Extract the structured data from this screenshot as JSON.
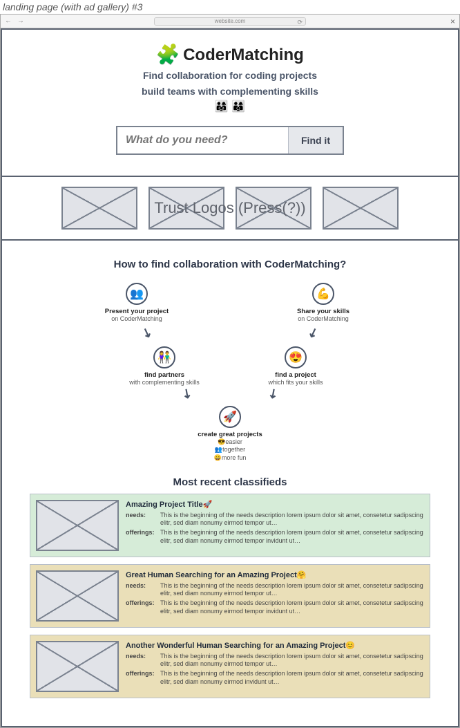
{
  "meta": {
    "page_label": "landing page (with ad gallery) #3"
  },
  "browser": {
    "url": "website.com"
  },
  "hero": {
    "brand": "CoderMatching",
    "tagline_1": "Find collaboration for coding projects",
    "tagline_2": "build teams with complementing skills",
    "emojis": "👨‍👩‍👧 👨‍👩‍👦",
    "search_placeholder": "What do you need?",
    "search_button": "Find it"
  },
  "trust": {
    "label": "Trust Logos (Press(?))"
  },
  "how": {
    "heading": "How to find collaboration with CoderMatching?",
    "n1_title": "Present your project",
    "n1_sub": "on CoderMatching",
    "n2_title": "Share your skills",
    "n2_sub": "on CoderMatching",
    "n3_title": "find partners",
    "n3_sub": "with complementing skills",
    "n4_title": "find a project",
    "n4_sub": "which fits your skills",
    "n5_title": "create great projects",
    "n5_line1": "😎easier",
    "n5_line2": "👥together",
    "n5_line3": "😄more fun"
  },
  "classifieds": {
    "heading": "Most recent classifieds",
    "needs_label": "needs:",
    "offerings_label": "offerings:",
    "items": [
      {
        "title": "Amazing Project Title🚀",
        "needs": "This is the beginning of the needs description lorem ipsum dolor sit amet, consetetur sadipscing elitr, sed diam nonumy eirmod tempor ut…",
        "offerings": "This is the beginning of the needs description lorem ipsum dolor sit amet, consetetur sadipscing elitr, sed diam nonumy eirmod tempor invidunt ut…"
      },
      {
        "title": "Great Human Searching for an Amazing Project🤗",
        "needs": "This is the beginning of the needs description lorem ipsum dolor sit amet, consetetur sadipscing elitr, sed diam nonumy eirmod tempor ut…",
        "offerings": "This is the beginning of the needs description lorem ipsum dolor sit amet, consetetur sadipscing elitr, sed diam nonumy eirmod tempor invidunt ut…"
      },
      {
        "title": "Another Wonderful Human Searching for an Amazing Project😊",
        "needs": "This is the beginning of the needs description lorem ipsum dolor sit amet, consetetur sadipscing elitr, sed diam nonumy eirmod tempor ut…",
        "offerings": "This is the beginning of the needs description lorem ipsum dolor sit amet, consetetur sadipscing elitr, sed diam nonumy eirmod invidunt ut…"
      }
    ]
  }
}
